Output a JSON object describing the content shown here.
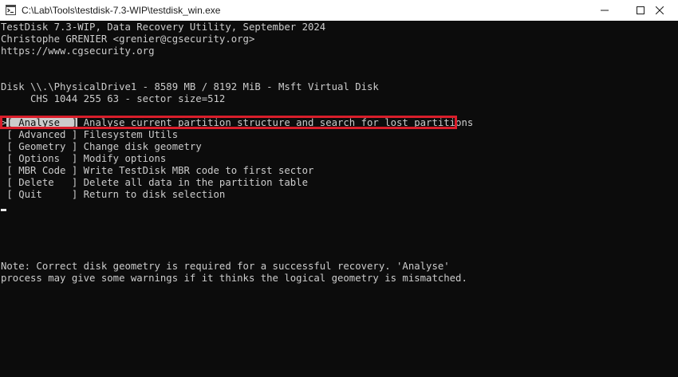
{
  "window": {
    "title": "C:\\Lab\\Tools\\testdisk-7.3-WIP\\testdisk_win.exe"
  },
  "header": {
    "line1": "TestDisk 7.3-WIP, Data Recovery Utility, September 2024",
    "line2": "Christophe GRENIER <grenier@cgsecurity.org>",
    "line3": "https://www.cgsecurity.org"
  },
  "disk": {
    "line1": "Disk \\\\.\\PhysicalDrive1 - 8589 MB / 8192 MiB - Msft Virtual Disk",
    "line2": "     CHS 1044 255 63 - sector size=512"
  },
  "menu": {
    "pointer": ">",
    "items": [
      {
        "label": "[ Analyse  ]",
        "desc": " Analyse current partition structure and search for lost partitions"
      },
      {
        "label": "[ Advanced ]",
        "desc": " Filesystem Utils"
      },
      {
        "label": "[ Geometry ]",
        "desc": " Change disk geometry"
      },
      {
        "label": "[ Options  ]",
        "desc": " Modify options"
      },
      {
        "label": "[ MBR Code ]",
        "desc": " Write TestDisk MBR code to first sector"
      },
      {
        "label": "[ Delete   ]",
        "desc": " Delete all data in the partition table"
      },
      {
        "label": "[ Quit     ]",
        "desc": " Return to disk selection"
      }
    ]
  },
  "note": {
    "line1": "Note: Correct disk geometry is required for a successful recovery. 'Analyse'",
    "line2": "process may give some warnings if it thinks the logical geometry is mismatched."
  },
  "icons": {
    "app": "terminal-app-icon",
    "minimize": "minimize-icon",
    "maximize": "maximize-icon",
    "close": "close-icon"
  },
  "colors": {
    "background": "#0c0c0c",
    "text": "#cccccc",
    "highlight_border": "#d91e2b"
  }
}
